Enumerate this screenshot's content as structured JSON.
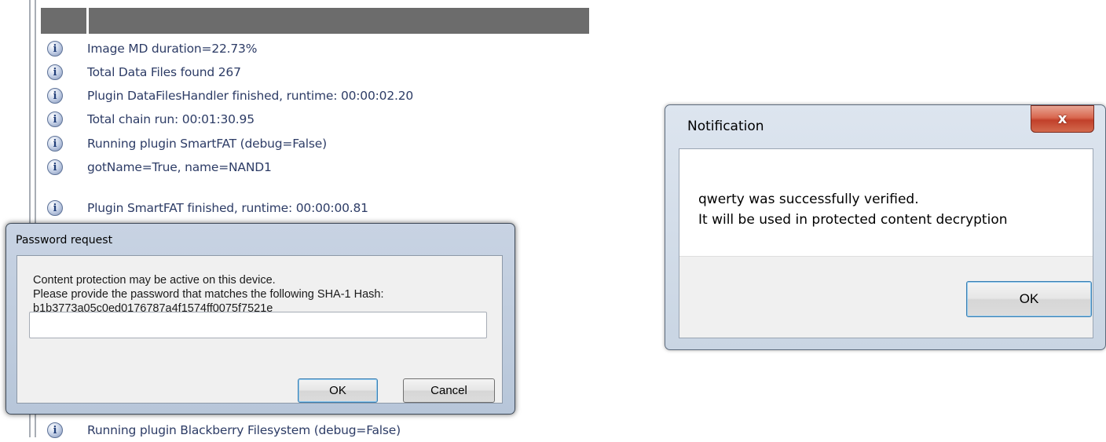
{
  "log": {
    "rows": [
      "Image MD duration=22.73%",
      "Total Data Files found 267",
      "Plugin DataFilesHandler finished, runtime: 00:00:02.20",
      "Total chain run: 00:01:30.95",
      "Running plugin SmartFAT (debug=False)",
      "gotName=True, name=NAND1",
      "Plugin SmartFAT finished, runtime: 00:00:00.81",
      "Running plugin Blackberry Filesystem (debug=False)"
    ],
    "row_icon": "info-icon",
    "icon_glyph": "i"
  },
  "password_dialog": {
    "title": "Password request",
    "message_lines": [
      "Content protection may be active on this device.",
      "Please provide the password that matches the following SHA-1 Hash:",
      "b1b3773a05c0ed0176787a4f1574ff0075f7521e"
    ],
    "password_value": "",
    "ok_label": "OK",
    "cancel_label": "Cancel"
  },
  "notification": {
    "title": "Notification",
    "close_glyph": "x",
    "message_lines": [
      "qwerty was successfully verified.",
      "It will be used in protected content decryption"
    ],
    "ok_label": "OK"
  },
  "colors": {
    "log_text": "#2d3c66",
    "header_bar": "#6c6c6c",
    "close_button": "#c1402a",
    "dialog_frame": "#b7c6d9"
  }
}
